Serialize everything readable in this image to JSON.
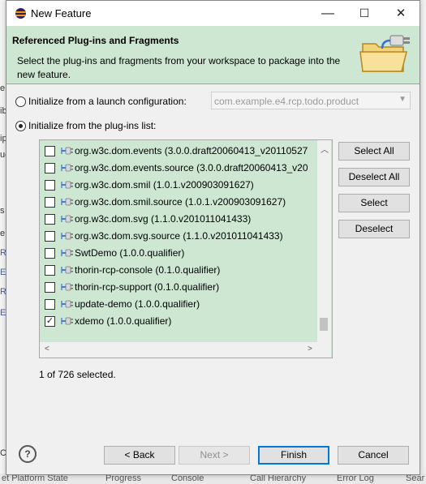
{
  "window": {
    "title": "New Feature",
    "minimize": "—",
    "maximize": "☐",
    "close": "✕"
  },
  "banner": {
    "heading": "Referenced Plug-ins and Fragments",
    "description": "Select the plug-ins and fragments from your workspace to package into the new feature."
  },
  "options": {
    "launch_config": {
      "label": "Initialize from a launch configuration:",
      "value": "com.example.e4.rcp.todo.product",
      "selected": false
    },
    "plugin_list": {
      "label": "Initialize from the plug-ins list:",
      "selected": true
    }
  },
  "plugins": [
    {
      "label": "org.w3c.dom.events (3.0.0.draft20060413_v20110527",
      "checked": false
    },
    {
      "label": "org.w3c.dom.events.source (3.0.0.draft20060413_v20",
      "checked": false
    },
    {
      "label": "org.w3c.dom.smil (1.0.1.v200903091627)",
      "checked": false
    },
    {
      "label": "org.w3c.dom.smil.source (1.0.1.v200903091627)",
      "checked": false
    },
    {
      "label": "org.w3c.dom.svg (1.1.0.v201011041433)",
      "checked": false
    },
    {
      "label": "org.w3c.dom.svg.source (1.1.0.v201011041433)",
      "checked": false
    },
    {
      "label": "SwtDemo (1.0.0.qualifier)",
      "checked": false
    },
    {
      "label": "thorin-rcp-console (0.1.0.qualifier)",
      "checked": false
    },
    {
      "label": "thorin-rcp-support (0.1.0.qualifier)",
      "checked": false
    },
    {
      "label": "update-demo (1.0.0.qualifier)",
      "checked": false
    },
    {
      "label": "xdemo (1.0.0.qualifier)",
      "checked": true
    }
  ],
  "side_buttons": {
    "select_all": "Select All",
    "deselect_all": "Deselect All",
    "select": "Select",
    "deselect": "Deselect"
  },
  "status": "1 of 726 selected.",
  "footer": {
    "back": "< Back",
    "next": "Next >",
    "finish": "Finish",
    "cancel": "Cancel",
    "help": "?"
  },
  "background": {
    "left_fragments": [
      "e",
      "ib",
      "ip",
      "uc",
      "s",
      "e",
      "RA",
      "E",
      "RA",
      "E",
      "Co"
    ],
    "bottom_tabs": [
      "et Platform State",
      "Progress",
      "Console",
      "Call Hierarchy",
      "Error Log",
      "Sear"
    ]
  },
  "colors": {
    "banner_bg": "#cde7d3",
    "list_bg": "#cde7d3",
    "primary_border": "#0078d7",
    "plugin_icon": "#3a6fd8"
  }
}
